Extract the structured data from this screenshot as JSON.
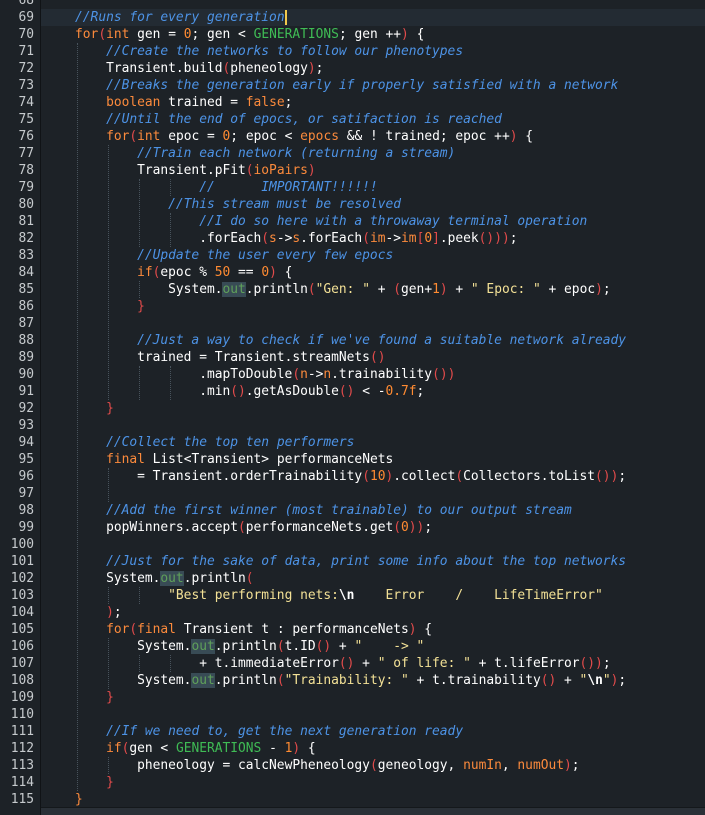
{
  "theme": {
    "background": "#1d2227",
    "keyword": "#fb8a3c",
    "comment": "#4d93e6",
    "constant": "#3fbc55",
    "string": "#f3e196",
    "number": "#ff8b32",
    "bracket": "#e24b4b",
    "operator": "#ffffff",
    "text": "#ffffff",
    "field": "#5fa05a",
    "line_number": "#c6cacd"
  },
  "editor": {
    "first_line": 68,
    "lines": [
      {
        "n": "68",
        "indent": 0,
        "t": []
      },
      {
        "n": "69",
        "indent": 4,
        "current": true,
        "t": [
          [
            "c",
            "//Runs for every generation"
          ]
        ]
      },
      {
        "n": "70",
        "indent": 4,
        "t": [
          [
            "k",
            "for"
          ],
          [
            "b",
            "("
          ],
          [
            "k",
            "int"
          ],
          [
            "x",
            " gen = "
          ],
          [
            "m",
            "0"
          ],
          [
            "x",
            "; gen < "
          ],
          [
            "g",
            "GENERATIONS"
          ],
          [
            "x",
            "; gen ++"
          ],
          [
            "b",
            ")"
          ],
          [
            "x",
            " {"
          ]
        ]
      },
      {
        "n": "71",
        "indent": 8,
        "t": [
          [
            "c",
            "//Create the networks to follow our phenotypes"
          ]
        ]
      },
      {
        "n": "72",
        "indent": 8,
        "t": [
          [
            "x",
            "Transient.build"
          ],
          [
            "b",
            "("
          ],
          [
            "x",
            "pheneology"
          ],
          [
            "b",
            ")"
          ],
          [
            "x",
            ";"
          ]
        ]
      },
      {
        "n": "73",
        "indent": 8,
        "t": [
          [
            "c",
            "//Breaks the generation early if properly satisfied with a network"
          ]
        ]
      },
      {
        "n": "74",
        "indent": 8,
        "t": [
          [
            "k",
            "boolean"
          ],
          [
            "x",
            " trained = "
          ],
          [
            "k",
            "false"
          ],
          [
            "x",
            ";"
          ]
        ]
      },
      {
        "n": "75",
        "indent": 8,
        "t": [
          [
            "c",
            "//Until the end of epocs, or satifaction is reached"
          ]
        ]
      },
      {
        "n": "76",
        "indent": 8,
        "t": [
          [
            "k",
            "for"
          ],
          [
            "b",
            "("
          ],
          [
            "k",
            "int"
          ],
          [
            "x",
            " epoc = "
          ],
          [
            "m",
            "0"
          ],
          [
            "x",
            "; epoc < "
          ],
          [
            "k",
            "epocs"
          ],
          [
            "x",
            " && ! trained; epoc ++"
          ],
          [
            "b",
            ")"
          ],
          [
            "x",
            " {"
          ]
        ]
      },
      {
        "n": "77",
        "indent": 12,
        "t": [
          [
            "c",
            "//Train each network (returning a stream)"
          ]
        ]
      },
      {
        "n": "78",
        "indent": 12,
        "t": [
          [
            "x",
            "Transient.pFit"
          ],
          [
            "b",
            "("
          ],
          [
            "k",
            "ioPairs"
          ],
          [
            "b",
            ")"
          ]
        ]
      },
      {
        "n": "79",
        "indent": 20,
        "t": [
          [
            "c",
            "//      IMPORTANT!!!!!!"
          ]
        ]
      },
      {
        "n": "80",
        "indent": 16,
        "t": [
          [
            "c",
            "//This stream must be resolved"
          ]
        ]
      },
      {
        "n": "81",
        "indent": 20,
        "t": [
          [
            "c",
            "//I do so here with a throwaway terminal operation"
          ]
        ]
      },
      {
        "n": "82",
        "indent": 20,
        "t": [
          [
            "x",
            ".forEach"
          ],
          [
            "b",
            "("
          ],
          [
            "k",
            "s"
          ],
          [
            "x",
            "->"
          ],
          [
            "k",
            "s"
          ],
          [
            "x",
            ".forEach"
          ],
          [
            "b",
            "("
          ],
          [
            "k",
            "im"
          ],
          [
            "x",
            "->"
          ],
          [
            "k",
            "im"
          ],
          [
            "b",
            "["
          ],
          [
            "m",
            "0"
          ],
          [
            "b",
            "]"
          ],
          [
            "x",
            ".peek"
          ],
          [
            "b",
            "()"
          ],
          [
            "b",
            ")"
          ],
          [
            "b",
            ")"
          ],
          [
            "x",
            ";"
          ]
        ]
      },
      {
        "n": "83",
        "indent": 12,
        "t": [
          [
            "c",
            "//Update the user every few epocs"
          ]
        ]
      },
      {
        "n": "84",
        "indent": 12,
        "t": [
          [
            "k",
            "if"
          ],
          [
            "b",
            "("
          ],
          [
            "x",
            "epoc % "
          ],
          [
            "m",
            "50"
          ],
          [
            "x",
            " == "
          ],
          [
            "m",
            "0"
          ],
          [
            "b",
            ")"
          ],
          [
            "x",
            " {"
          ]
        ]
      },
      {
        "n": "85",
        "indent": 16,
        "t": [
          [
            "x",
            "System."
          ],
          [
            "f",
            "out"
          ],
          [
            "x",
            ".println"
          ],
          [
            "b",
            "("
          ],
          [
            "s",
            "\"Gen: \""
          ],
          [
            "x",
            " + "
          ],
          [
            "b",
            "("
          ],
          [
            "x",
            "gen+"
          ],
          [
            "m",
            "1"
          ],
          [
            "b",
            ")"
          ],
          [
            "x",
            " + "
          ],
          [
            "s",
            "\" Epoc: \""
          ],
          [
            "x",
            " + epoc"
          ],
          [
            "b",
            ")"
          ],
          [
            "x",
            ";"
          ]
        ]
      },
      {
        "n": "86",
        "indent": 12,
        "t": [
          [
            "b",
            "}"
          ]
        ]
      },
      {
        "n": "87",
        "indent": 0,
        "t": []
      },
      {
        "n": "88",
        "indent": 12,
        "t": [
          [
            "c",
            "//Just a way to check if we've found a suitable network already"
          ]
        ]
      },
      {
        "n": "89",
        "indent": 12,
        "t": [
          [
            "x",
            "trained = Transient.streamNets"
          ],
          [
            "b",
            "()"
          ]
        ]
      },
      {
        "n": "90",
        "indent": 20,
        "t": [
          [
            "x",
            ".mapToDouble"
          ],
          [
            "b",
            "("
          ],
          [
            "k",
            "n"
          ],
          [
            "x",
            "->"
          ],
          [
            "k",
            "n"
          ],
          [
            "x",
            ".trainability"
          ],
          [
            "b",
            "()"
          ],
          [
            "b",
            ")"
          ]
        ]
      },
      {
        "n": "91",
        "indent": 20,
        "t": [
          [
            "x",
            ".min"
          ],
          [
            "b",
            "()"
          ],
          [
            "x",
            ".getAsDouble"
          ],
          [
            "b",
            "()"
          ],
          [
            "x",
            " < -"
          ],
          [
            "m",
            "0.7f"
          ],
          [
            "x",
            ";"
          ]
        ]
      },
      {
        "n": "92",
        "indent": 8,
        "t": [
          [
            "b",
            "}"
          ]
        ]
      },
      {
        "n": "93",
        "indent": 0,
        "t": []
      },
      {
        "n": "94",
        "indent": 8,
        "t": [
          [
            "c",
            "//Collect the top ten performers"
          ]
        ]
      },
      {
        "n": "95",
        "indent": 8,
        "t": [
          [
            "k",
            "final"
          ],
          [
            "x",
            " List<Transient> performanceNets"
          ]
        ]
      },
      {
        "n": "96",
        "indent": 12,
        "t": [
          [
            "x",
            "= Transient.orderTrainability"
          ],
          [
            "b",
            "("
          ],
          [
            "m",
            "10"
          ],
          [
            "b",
            ")"
          ],
          [
            "x",
            ".collect"
          ],
          [
            "b",
            "("
          ],
          [
            "x",
            "Collectors.toList"
          ],
          [
            "b",
            "()"
          ],
          [
            "b",
            ")"
          ],
          [
            "x",
            ";"
          ]
        ]
      },
      {
        "n": "97",
        "indent": 0,
        "t": []
      },
      {
        "n": "98",
        "indent": 8,
        "t": [
          [
            "c",
            "//Add the first winner (most trainable) to our output stream"
          ]
        ]
      },
      {
        "n": "99",
        "indent": 8,
        "t": [
          [
            "x",
            "popWinners.accept"
          ],
          [
            "b",
            "("
          ],
          [
            "x",
            "performanceNets.get"
          ],
          [
            "b",
            "("
          ],
          [
            "m",
            "0"
          ],
          [
            "b",
            ")"
          ],
          [
            "b",
            ")"
          ],
          [
            "x",
            ";"
          ]
        ]
      },
      {
        "n": "100",
        "indent": 0,
        "t": []
      },
      {
        "n": "101",
        "indent": 8,
        "t": [
          [
            "c",
            "//Just for the sake of data, print some info about the top networks"
          ]
        ]
      },
      {
        "n": "102",
        "indent": 8,
        "t": [
          [
            "x",
            "System."
          ],
          [
            "f",
            "out"
          ],
          [
            "x",
            ".println"
          ],
          [
            "b",
            "("
          ]
        ]
      },
      {
        "n": "103",
        "indent": 16,
        "t": [
          [
            "s",
            "\"Best performing nets:"
          ],
          [
            "e",
            "\\n"
          ],
          [
            "s",
            "    Error    /    LifeTimeError\""
          ]
        ]
      },
      {
        "n": "104",
        "indent": 8,
        "t": [
          [
            "b",
            ")"
          ],
          [
            "x",
            ";"
          ]
        ]
      },
      {
        "n": "105",
        "indent": 8,
        "t": [
          [
            "k",
            "for"
          ],
          [
            "b",
            "("
          ],
          [
            "k",
            "final"
          ],
          [
            "x",
            " Transient t : performanceNets"
          ],
          [
            "b",
            ")"
          ],
          [
            "x",
            " {"
          ]
        ]
      },
      {
        "n": "106",
        "indent": 12,
        "t": [
          [
            "x",
            "System."
          ],
          [
            "f",
            "out"
          ],
          [
            "x",
            ".println"
          ],
          [
            "b",
            "("
          ],
          [
            "x",
            "t.ID"
          ],
          [
            "b",
            "()"
          ],
          [
            "x",
            " + "
          ],
          [
            "s",
            "\"    -> \""
          ]
        ]
      },
      {
        "n": "107",
        "indent": 20,
        "t": [
          [
            "x",
            "+ t.immediateError"
          ],
          [
            "b",
            "()"
          ],
          [
            "x",
            " + "
          ],
          [
            "s",
            "\" of life: \""
          ],
          [
            "x",
            " + t.lifeError"
          ],
          [
            "b",
            "()"
          ],
          [
            "b",
            ")"
          ],
          [
            "x",
            ";"
          ]
        ]
      },
      {
        "n": "108",
        "indent": 12,
        "t": [
          [
            "x",
            "System."
          ],
          [
            "f",
            "out"
          ],
          [
            "x",
            ".println"
          ],
          [
            "b",
            "("
          ],
          [
            "s",
            "\"Trainability: \""
          ],
          [
            "x",
            " + t.trainability"
          ],
          [
            "b",
            "()"
          ],
          [
            "x",
            " + "
          ],
          [
            "s",
            "\""
          ],
          [
            "e",
            "\\n"
          ],
          [
            "s",
            "\""
          ],
          [
            "b",
            ")"
          ],
          [
            "x",
            ";"
          ]
        ]
      },
      {
        "n": "109",
        "indent": 8,
        "t": [
          [
            "b",
            "}"
          ]
        ]
      },
      {
        "n": "110",
        "indent": 0,
        "t": []
      },
      {
        "n": "111",
        "indent": 8,
        "t": [
          [
            "c",
            "//If we need to, get the next generation ready"
          ]
        ]
      },
      {
        "n": "112",
        "indent": 8,
        "t": [
          [
            "k",
            "if"
          ],
          [
            "b",
            "("
          ],
          [
            "x",
            "gen < "
          ],
          [
            "g",
            "GENERATIONS"
          ],
          [
            "x",
            " - "
          ],
          [
            "m",
            "1"
          ],
          [
            "b",
            ")"
          ],
          [
            "x",
            " {"
          ]
        ]
      },
      {
        "n": "113",
        "indent": 12,
        "t": [
          [
            "x",
            "pheneology = calcNewPheneology"
          ],
          [
            "b",
            "("
          ],
          [
            "x",
            "geneology, "
          ],
          [
            "k",
            "numIn"
          ],
          [
            "x",
            ", "
          ],
          [
            "k",
            "numOut"
          ],
          [
            "b",
            ")"
          ],
          [
            "x",
            ";"
          ]
        ]
      },
      {
        "n": "114",
        "indent": 8,
        "t": [
          [
            "b",
            "}"
          ]
        ]
      },
      {
        "n": "115",
        "indent": 4,
        "t": [
          [
            "k",
            "}"
          ]
        ]
      }
    ]
  }
}
